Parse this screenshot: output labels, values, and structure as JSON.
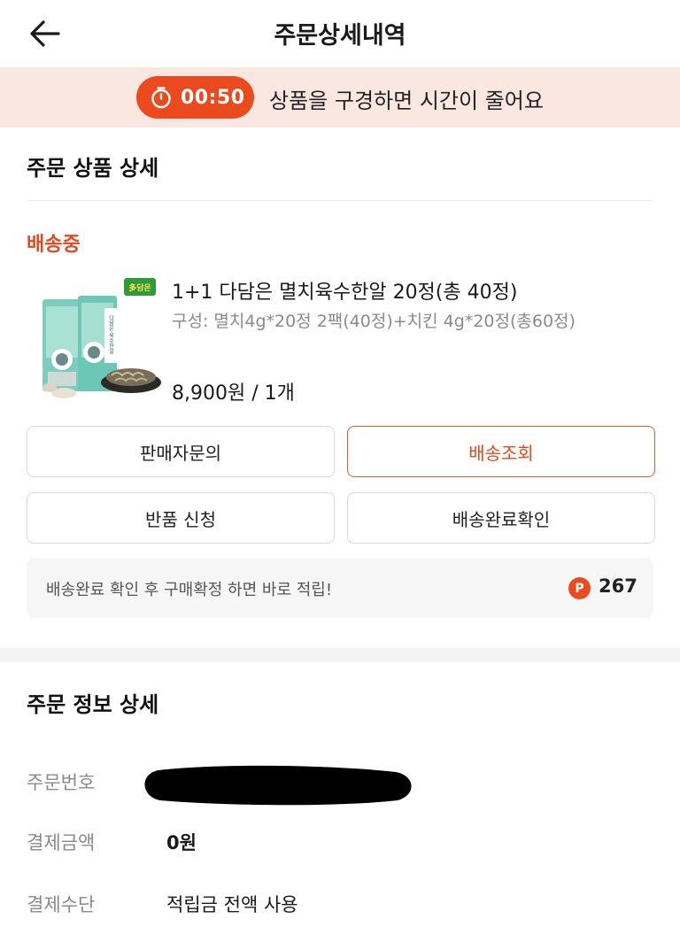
{
  "header": {
    "title": "주문상세내역",
    "back_icon": "arrow-left-icon"
  },
  "timer_banner": {
    "time": "00:50",
    "message": "상품을 구경하면 시간이 줄어요",
    "icon": "stopwatch-icon",
    "accent_color": "#ea4a1e"
  },
  "order_product": {
    "section_title": "주문 상품 상세",
    "status": "배송중",
    "status_color": "#e14a1e",
    "product": {
      "name": "1+1 다담은 멸치육수한알 20정(총 40정)",
      "option": "구성: 멸치4g*20정 2팩(40정)+치킨 4g*20정(총60정)",
      "price": "8,900원 / 1개",
      "thumb_brand_text": "多담은",
      "thumb_package_text": "다담은 육수한알"
    },
    "buttons": {
      "seller_inquiry": "판매자문의",
      "track_delivery": "배송조회",
      "return_request": "반품 신청",
      "confirm_delivery": "배송완료확인"
    },
    "points": {
      "message": "배송완료 확인 후 구매확정 하면 바로 적립!",
      "icon_label": "P",
      "value": "267"
    }
  },
  "order_info": {
    "section_title": "주문 정보 상세",
    "rows": [
      {
        "label": "주문번호",
        "value": ""
      },
      {
        "label": "결제금액",
        "value": "0원"
      },
      {
        "label": "결제수단",
        "value": "적립금 전액 사용"
      }
    ]
  }
}
